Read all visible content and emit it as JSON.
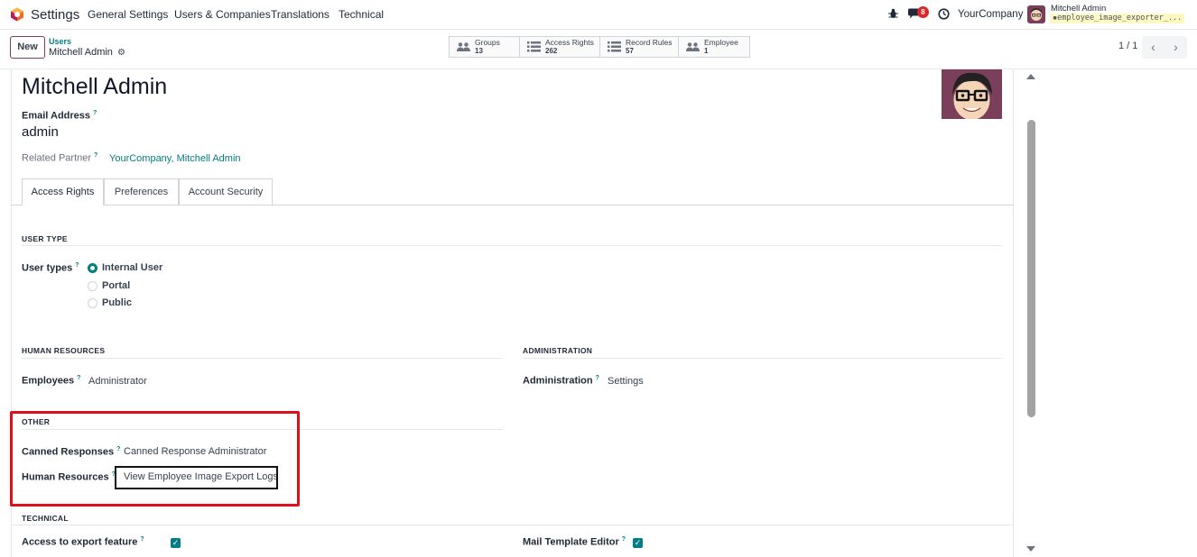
{
  "navbar": {
    "app_name": "Settings",
    "menu": [
      "General Settings",
      "Users & Companies",
      "Translations",
      "Technical"
    ],
    "chat_badge": "8",
    "company": "YourCompany",
    "user_name": "Mitchell Admin",
    "db_name": "employee_image_exporter_..."
  },
  "control": {
    "new_label": "New",
    "breadcrumb_parent": "Users",
    "breadcrumb_current": "Mitchell Admin",
    "smart_buttons": [
      {
        "label": "Groups",
        "value": "13",
        "icon": "users-icon"
      },
      {
        "label": "Access Rights",
        "value": "262",
        "icon": "list-icon"
      },
      {
        "label": "Record Rules",
        "value": "57",
        "icon": "list-icon"
      },
      {
        "label": "Employee",
        "value": "1",
        "icon": "users-icon"
      }
    ],
    "pager": "1 / 1"
  },
  "form": {
    "name": "Mitchell Admin",
    "email_label": "Email Address",
    "email_value": "admin",
    "partner_label": "Related Partner",
    "partner_value": "YourCompany, Mitchell Admin",
    "help_mark": "?",
    "tabs": [
      "Access Rights",
      "Preferences",
      "Account Security"
    ],
    "user_type": {
      "section": "USER TYPE",
      "label": "User types",
      "options": [
        "Internal User",
        "Portal",
        "Public"
      ],
      "selected": "Internal User"
    },
    "hr": {
      "section": "HUMAN RESOURCES",
      "label": "Employees",
      "value": "Administrator"
    },
    "admin": {
      "section": "ADMINISTRATION",
      "label": "Administration",
      "value": "Settings"
    },
    "other": {
      "section": "OTHER",
      "canned_label": "Canned Responses",
      "canned_value": "Canned Response Administrator",
      "hr_label": "Human Resources",
      "hr_value": "View Employee Image Export Logs"
    },
    "technical": {
      "section": "TECHNICAL",
      "export_label": "Access to export feature",
      "export_checked": true,
      "mail_label": "Mail Template Editor",
      "mail_checked": true
    }
  },
  "colors": {
    "accent": "#017e84",
    "brand": "#7b3f5c",
    "highlight_red": "#e0101a"
  }
}
